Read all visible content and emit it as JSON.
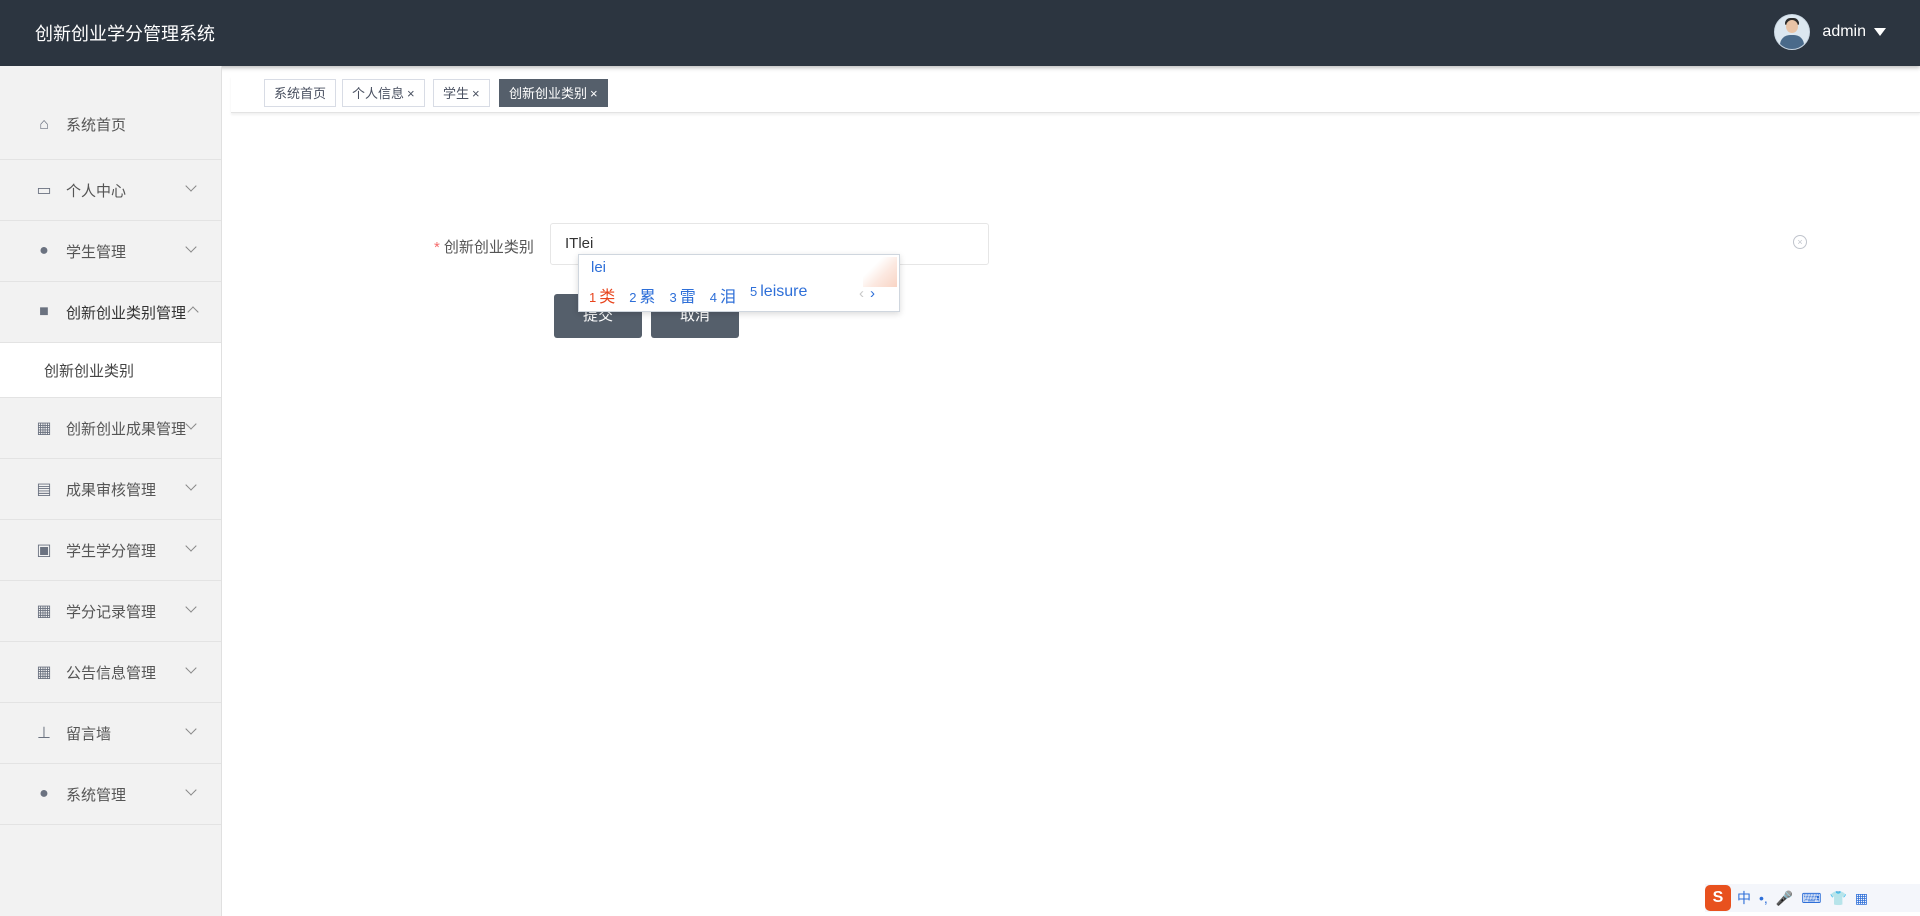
{
  "app": {
    "title": "创新创业学分管理系统"
  },
  "user": {
    "name": "admin"
  },
  "sidebar": {
    "items": [
      {
        "label": "系统首页",
        "icon": "home-icon"
      },
      {
        "label": "个人中心",
        "icon": "wallet-icon"
      },
      {
        "label": "学生管理",
        "icon": "bulb-icon"
      },
      {
        "label": "创新创业类别管理",
        "icon": "briefcase-icon"
      },
      {
        "label": "创新创业成果管理",
        "icon": "grid-icon"
      },
      {
        "label": "成果审核管理",
        "icon": "clipboard-icon"
      },
      {
        "label": "学生学分管理",
        "icon": "clipboard-x-icon"
      },
      {
        "label": "学分记录管理",
        "icon": "grid-icon"
      },
      {
        "label": "公告信息管理",
        "icon": "grid-icon"
      },
      {
        "label": "留言墙",
        "icon": "stamp-icon"
      },
      {
        "label": "系统管理",
        "icon": "person-icon"
      }
    ],
    "submenu": {
      "label": "创新创业类别"
    }
  },
  "tabs": [
    {
      "label": "系统首页",
      "closable": false
    },
    {
      "label": "个人信息",
      "closable": true
    },
    {
      "label": "学生",
      "closable": true
    },
    {
      "label": "创新创业类别",
      "closable": true,
      "active": true
    }
  ],
  "tab_close_glyph": "×",
  "form": {
    "required_mark": "*",
    "label": "创新创业类别",
    "value": "ITlei",
    "submit_label": "提交",
    "cancel_label": "取消"
  },
  "ime": {
    "composition": "lei",
    "candidates": [
      {
        "num": "1",
        "text": "类"
      },
      {
        "num": "2",
        "text": "累"
      },
      {
        "num": "3",
        "text": "雷"
      },
      {
        "num": "4",
        "text": "泪"
      },
      {
        "num": "5",
        "text": "leisure"
      }
    ],
    "prev": "‹",
    "next": "›"
  },
  "tray": {
    "logo": "S",
    "mode": "中",
    "punct": "•,",
    "mic": "🎤",
    "keyboard": "⌨",
    "skin": "👕",
    "apps": "▦"
  },
  "colors": {
    "topbar": "#2c3540",
    "active_tab": "#555f6b",
    "button": "#555f6b",
    "required": "#f56c6c",
    "ime_selected": "#e8451e",
    "ime_text": "#2e6fd8"
  }
}
